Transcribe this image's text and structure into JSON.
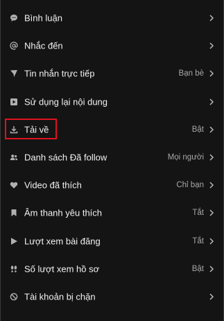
{
  "settings": {
    "items": [
      {
        "icon": "comment-icon",
        "label": "Bình luận",
        "value": ""
      },
      {
        "icon": "at-sign-icon",
        "label": "Nhắc đến",
        "value": ""
      },
      {
        "icon": "send-icon",
        "label": "Tin nhắn trực tiếp",
        "value": "Bạn bè"
      },
      {
        "icon": "reuse-icon",
        "label": "Sử dụng lại nội dung",
        "value": ""
      },
      {
        "icon": "download-icon",
        "label": "Tải về",
        "value": "Bật"
      },
      {
        "icon": "people-icon",
        "label": "Danh sách Đã follow",
        "value": "Mọi người"
      },
      {
        "icon": "heart-icon",
        "label": "Video đã thích",
        "value": "Chỉ bạn"
      },
      {
        "icon": "bookmark-icon",
        "label": "Âm thanh yêu thích",
        "value": "Tắt"
      },
      {
        "icon": "play-icon",
        "label": "Lượt xem bài đăng",
        "value": "Tắt"
      },
      {
        "icon": "footprints-icon",
        "label": "Số lượt xem hồ sơ",
        "value": "Bật"
      },
      {
        "icon": "block-icon",
        "label": "Tài khoản bị chặn",
        "value": ""
      }
    ]
  },
  "highlight": {
    "target": "Tải về",
    "color": "#e0121f"
  },
  "colors": {
    "background": "#141414",
    "text": "#f2f2f2",
    "secondary": "#a8a8a8",
    "icon": "#b0b0b0"
  }
}
